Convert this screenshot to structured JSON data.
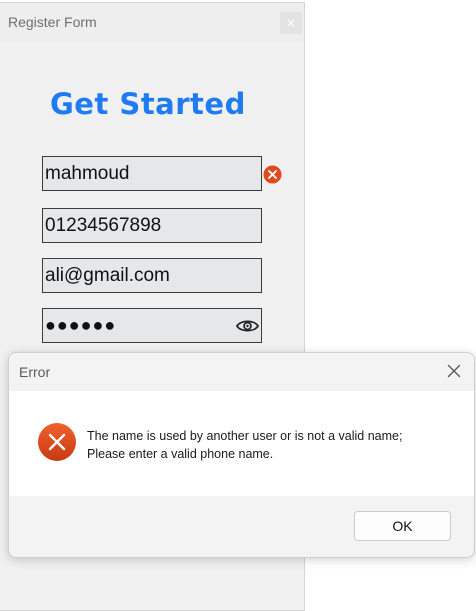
{
  "register_window": {
    "title": "Register Form",
    "close_label": "×",
    "heading": "Get Started",
    "fields": {
      "name": "mahmoud",
      "phone": "01234567898",
      "email": "ali@gmail.com",
      "password_masked": "●●●●●●"
    },
    "icons": {
      "name_error": "error-icon",
      "password_toggle": "eye-icon"
    }
  },
  "error_dialog": {
    "title": "Error",
    "message_line1": "The name is used by another user or is not a valid name;",
    "message_line2": "Please enter a valid phone name.",
    "ok_label": "OK",
    "error_color": "#e04a1f"
  }
}
